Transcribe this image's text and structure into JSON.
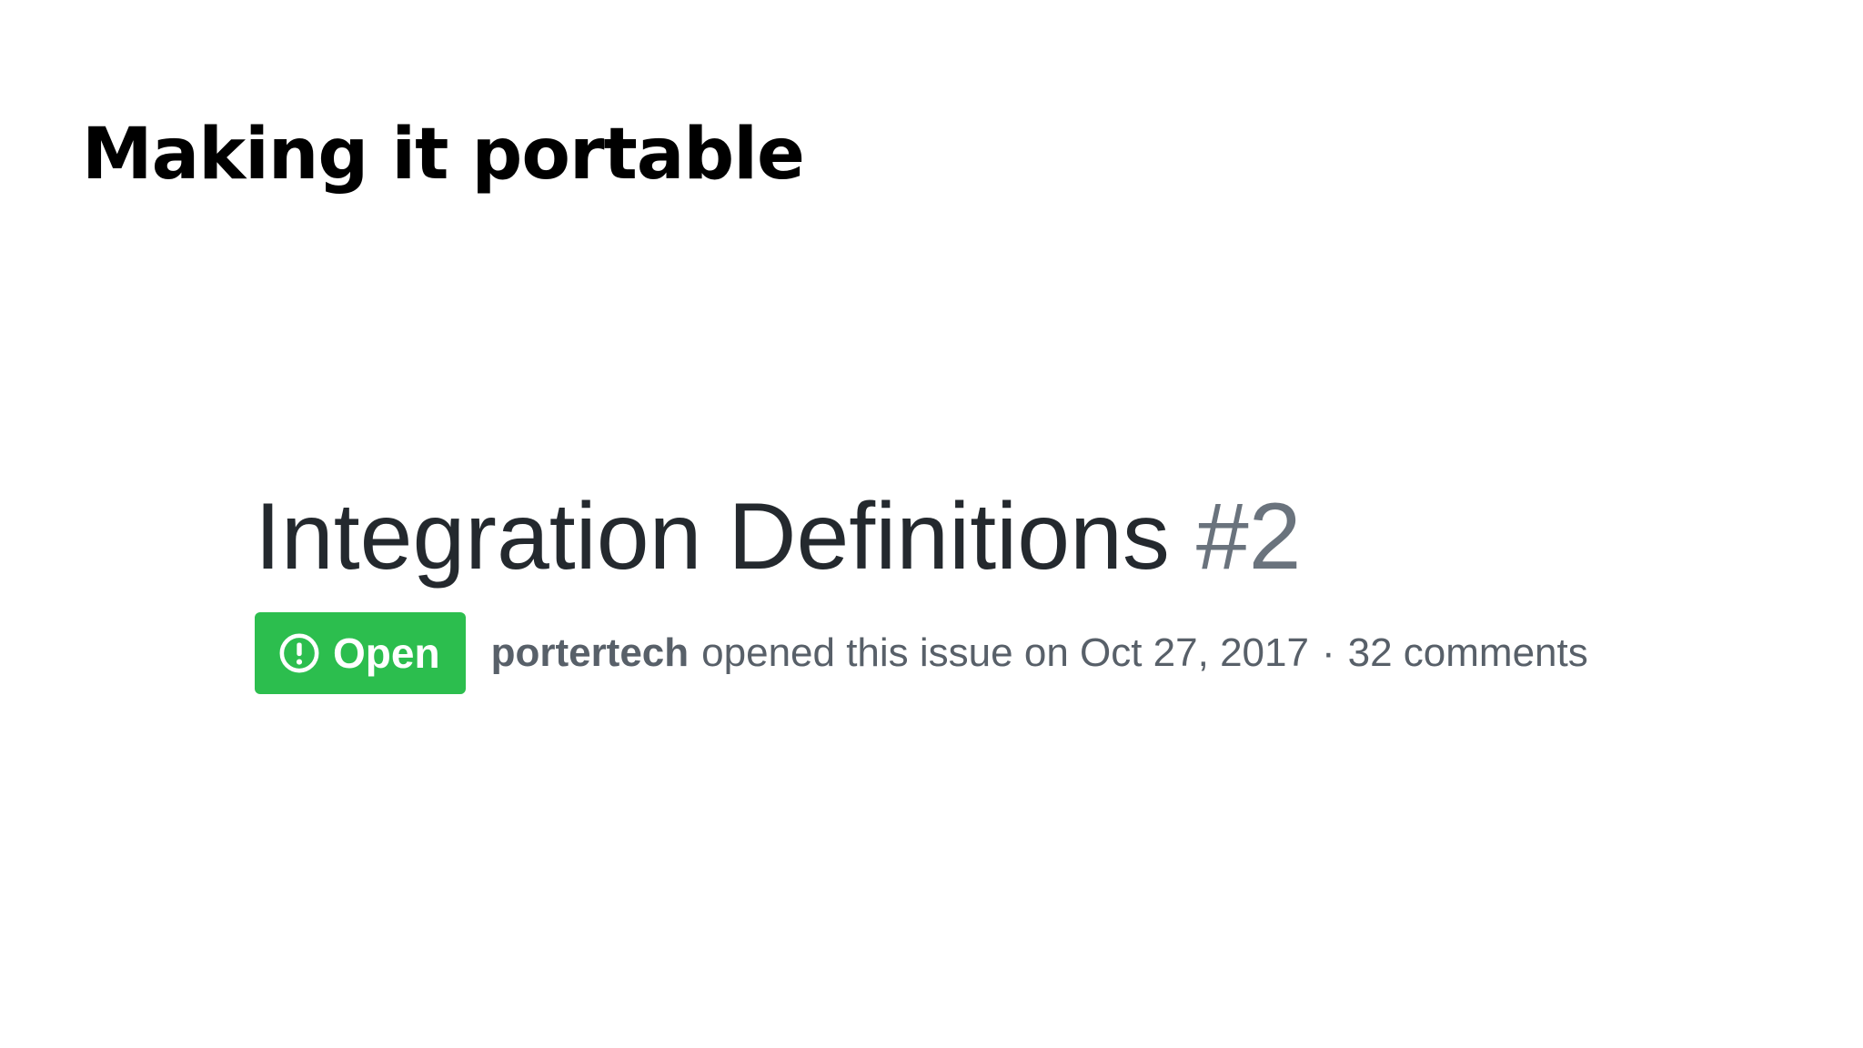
{
  "slide": {
    "title": "Making it portable"
  },
  "issue": {
    "title": "Integration Definitions",
    "number": "#2",
    "state": {
      "label": "Open",
      "icon": "issue-opened-icon",
      "color": "#2cbe4e"
    },
    "author": "portertech",
    "opened_text": "opened this issue on Oct 27, 2017",
    "separator": "·",
    "comments": "32 comments"
  }
}
